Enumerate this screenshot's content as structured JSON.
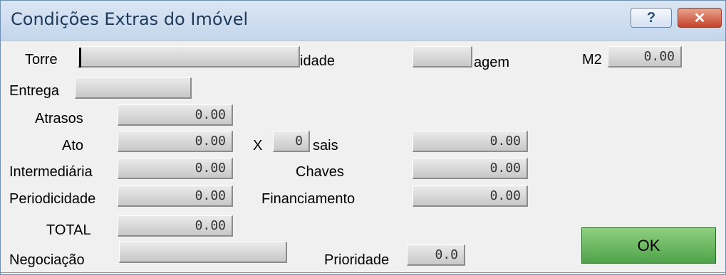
{
  "window": {
    "title": "Condições Extras do Imóvel",
    "help_label": "?",
    "close_label": "✕"
  },
  "fields": {
    "torre": {
      "label": "Torre",
      "value": ""
    },
    "cidade": {
      "label": "idade",
      "value": ""
    },
    "garagem": {
      "label": "agem",
      "value": ""
    },
    "m2": {
      "label": "M2",
      "value": "0.00"
    },
    "entrega": {
      "label": "Entrega",
      "value": ""
    },
    "atrasos": {
      "label": "Atrasos",
      "value": "0.00"
    },
    "ato": {
      "label": "Ato",
      "value": "0.00"
    },
    "x": {
      "label": "X",
      "value": "0"
    },
    "mensais": {
      "label": "sais",
      "value": "0.00"
    },
    "intermediaria": {
      "label": "Intermediária",
      "value": "0.00"
    },
    "chaves": {
      "label": "Chaves",
      "value": "0.00"
    },
    "periodicidade": {
      "label": "Periodicidade",
      "value": "0.00"
    },
    "financiamento": {
      "label": "Financiamento",
      "value": "0.00"
    },
    "total": {
      "label": "TOTAL",
      "value": "0.00"
    },
    "negociacao": {
      "label": "Negociação",
      "value": ""
    },
    "prioridade": {
      "label": "Prioridade",
      "value": "0.0"
    }
  },
  "buttons": {
    "ok": "OK"
  }
}
